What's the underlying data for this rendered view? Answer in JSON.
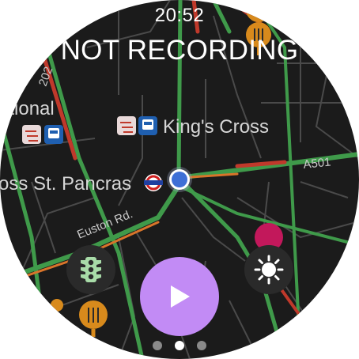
{
  "status_bar": {
    "time": "20:52"
  },
  "recording": {
    "status_text": "NOT RECORDING"
  },
  "map": {
    "labels": {
      "national": "ational",
      "kings_cross": "King's Cross",
      "st_pancras": "oss St. Pancras",
      "euston_rd": "Euston Rd.",
      "a501": "A501",
      "road_202": "202"
    },
    "icons": [
      "rail-icon",
      "train-icon",
      "underground-icon",
      "restaurant-icon",
      "location-dot-icon"
    ]
  },
  "controls": {
    "traffic_button_icon": "traffic-light-icon",
    "play_button_icon": "play-icon",
    "brightness_button_icon": "brightness-icon"
  },
  "pager": {
    "pages": 3,
    "active_index": 1
  },
  "colors": {
    "background": "#1b1b1b",
    "accent": "#c28bf5",
    "traffic_green": "#3f9a4a",
    "traffic_red": "#c0392b",
    "traffic_orange": "#d8742a",
    "poi_orange": "#d88a1c",
    "poi_pink": "#c2185b"
  }
}
